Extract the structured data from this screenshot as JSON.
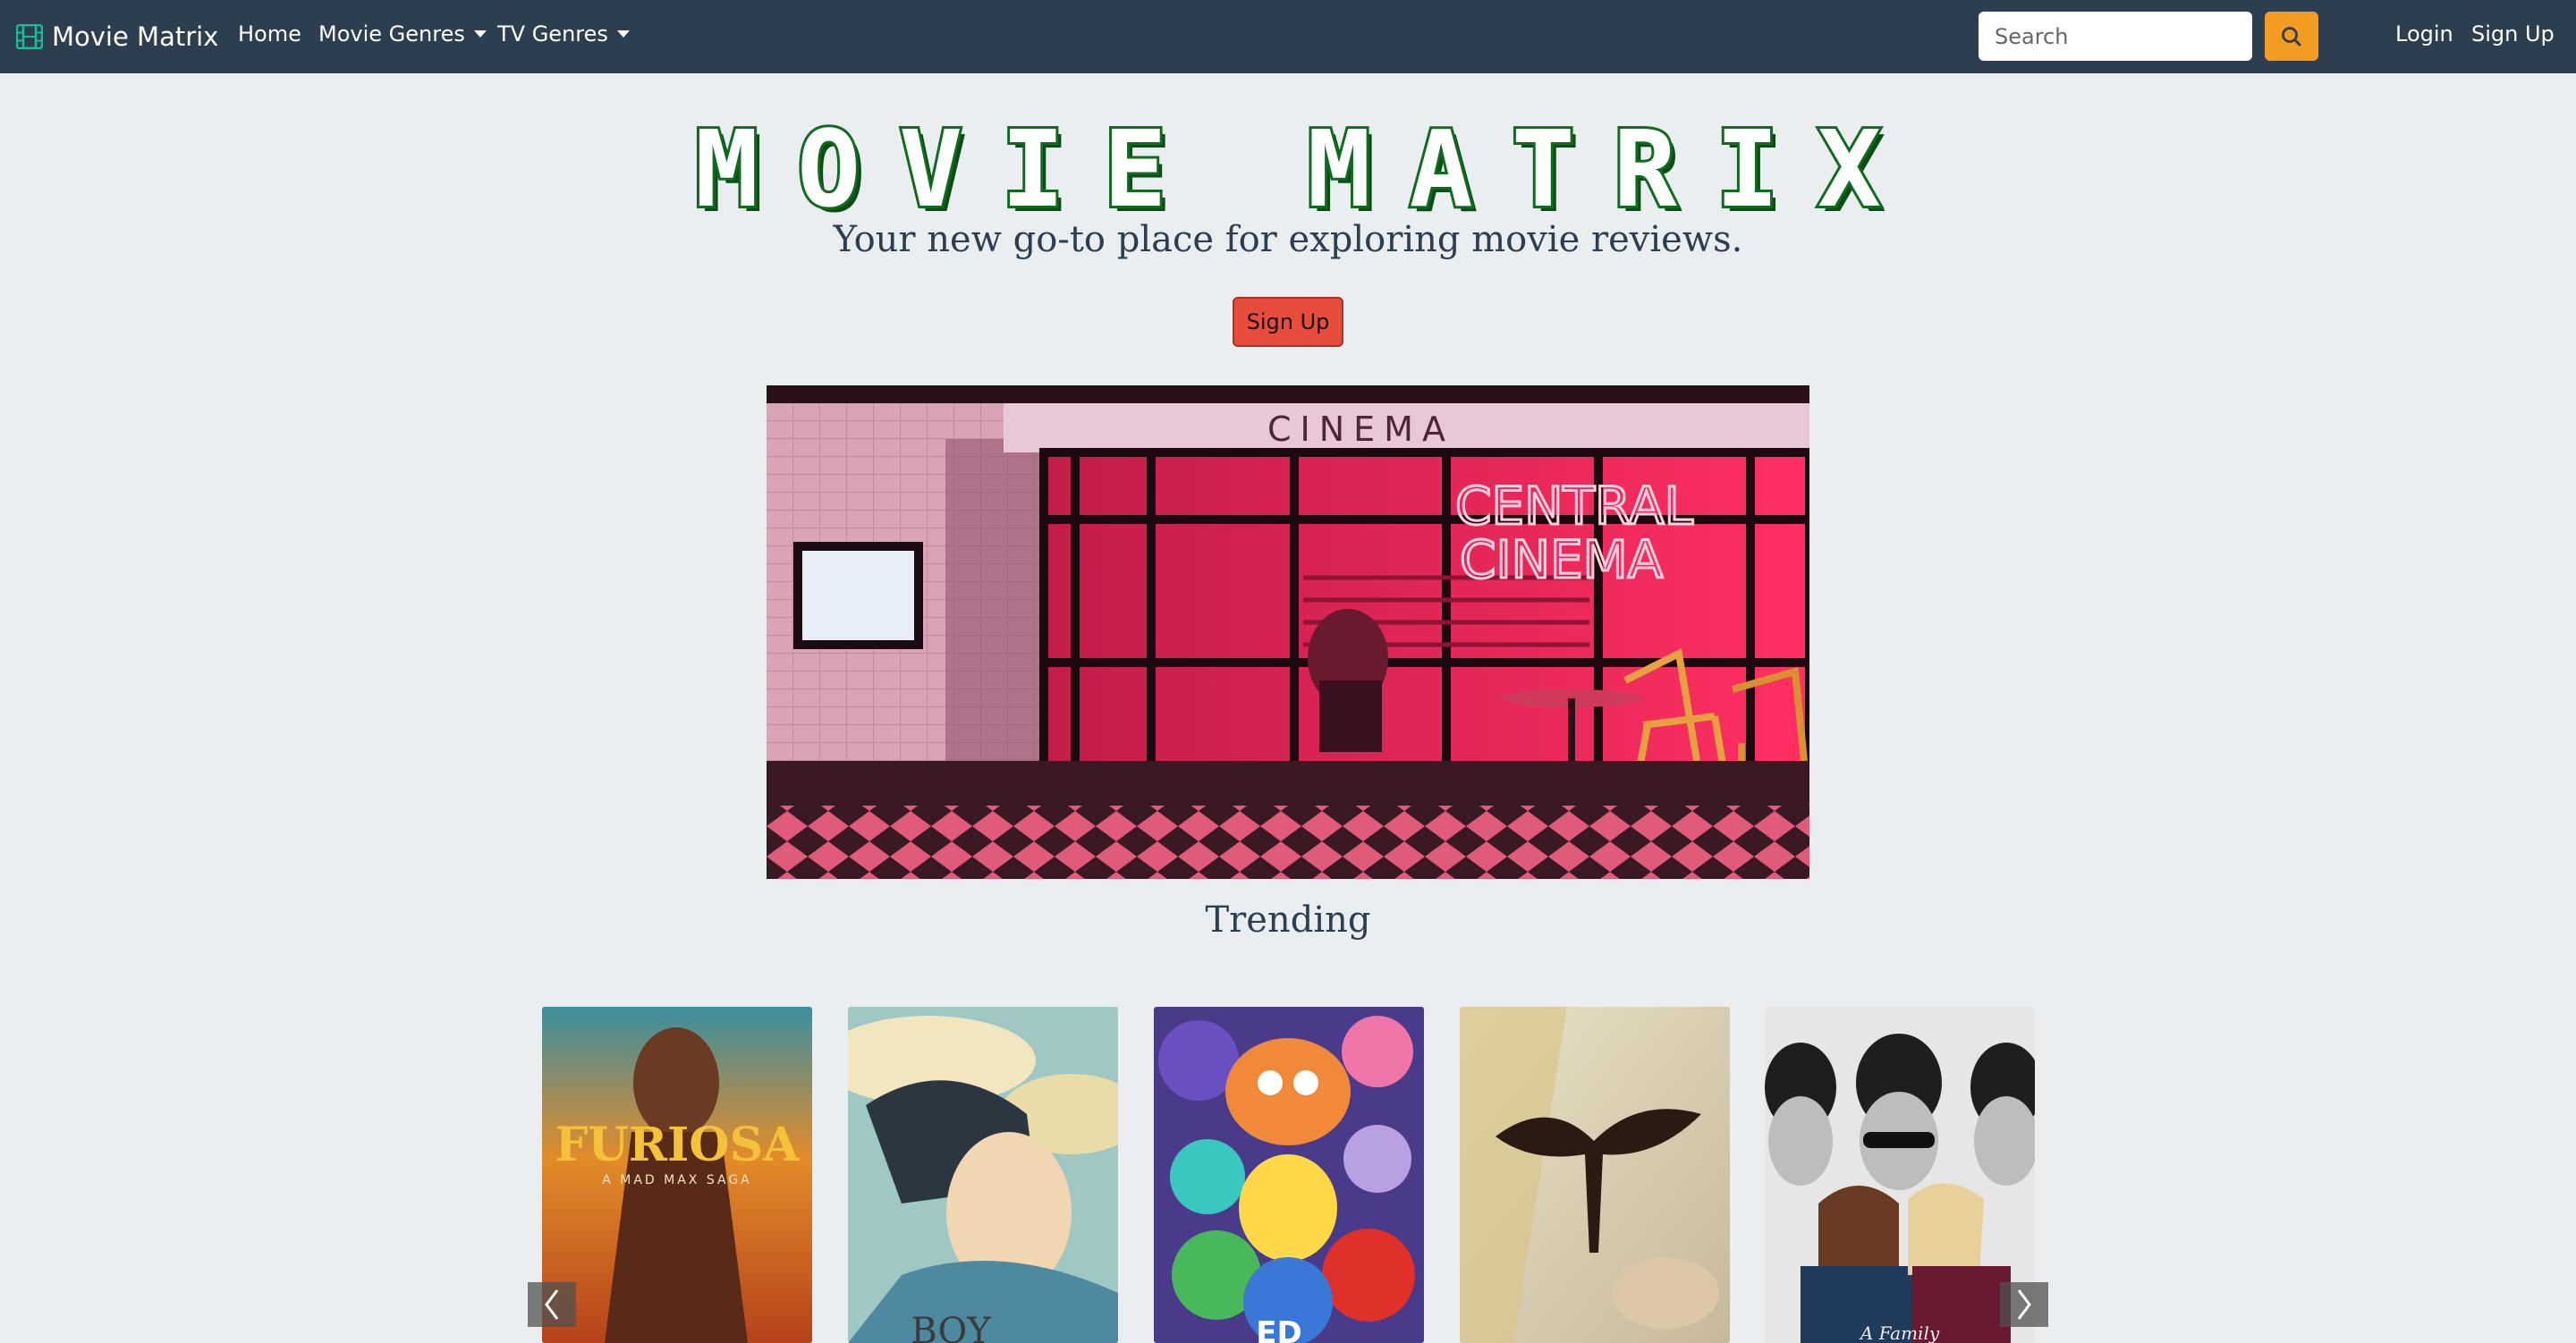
{
  "navbar": {
    "brand": "Movie Matrix",
    "links": [
      {
        "label": "Home"
      },
      {
        "label": "Movie Genres"
      },
      {
        "label": "TV Genres"
      }
    ],
    "search_placeholder": "Search",
    "login": "Login",
    "signup": "Sign Up"
  },
  "hero": {
    "title": "MOVIE MATRIX",
    "tagline": "Your new go-to place for exploring movie reviews.",
    "signup_button": "Sign Up"
  },
  "cinema_image": {
    "sign_top": "CINEMA",
    "neon_line1": "CENTRAL",
    "neon_line2": "CINEMA"
  },
  "trending": {
    "heading": "Trending",
    "posters": [
      {
        "title_text": "FURIOSA",
        "subtitle_text": "A MAD MAX SAGA"
      },
      {
        "title_text": "BOY"
      },
      {
        "title_text": "ED"
      },
      {
        "title_text": ""
      },
      {
        "title_text": "A Family"
      }
    ]
  },
  "colors": {
    "navbar": "#2c3e50",
    "accent_orange": "#f39c21",
    "signup_red": "#e74c3c",
    "title_green": "#0f6b1e",
    "background": "#ebeef0"
  }
}
